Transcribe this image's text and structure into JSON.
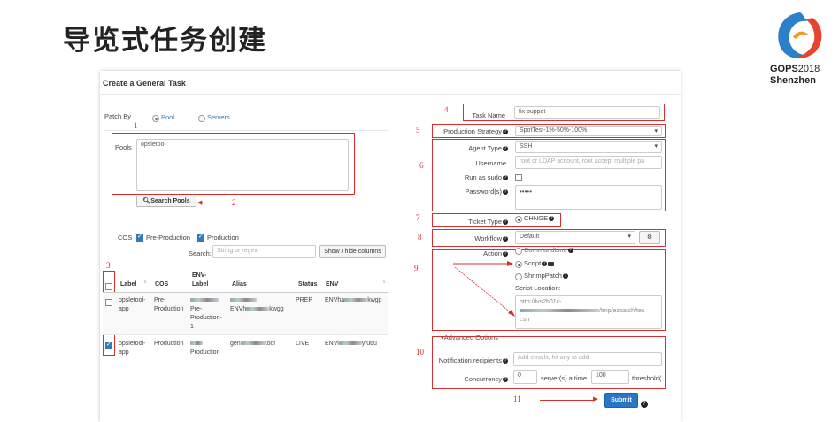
{
  "slide": {
    "title": "导览式任务创建",
    "logo": {
      "brand": "GOPS",
      "year": "2018",
      "city": "Shenzhen"
    }
  },
  "panel": {
    "title": "Create a General Task"
  },
  "left": {
    "patch_by": {
      "label": "Patch By",
      "options": [
        "Pool",
        "Servers"
      ],
      "selected": "Pool"
    },
    "pools": {
      "label": "Pools",
      "value": "opsletool"
    },
    "search_pools_button": "Search Pools",
    "filters": {
      "cos_label": "COS",
      "options": [
        "Pre-Production",
        "Production"
      ],
      "checked": [
        "Pre-Production",
        "Production"
      ]
    },
    "search": {
      "label": "Search:",
      "placeholder": "String or regex"
    },
    "show_hide_columns_button": "Show / hide columns",
    "table": {
      "headers": {
        "label": "Label",
        "cos": "COS",
        "env_label_1": "ENV-",
        "env_label_2": "Label",
        "alias": "Alias",
        "status": "Status",
        "env": "ENV"
      },
      "rows": [
        {
          "label_1": "opsletool-",
          "label_2": "app",
          "cos_1": "Pre-",
          "cos_2": "Production",
          "env_label_1": "Pre-",
          "env_label_2": "Production-",
          "env_label_3": "1",
          "alias": "",
          "env_alias": "ENVh",
          "env_alias_tail": "kwgg",
          "status": "PREP",
          "env": "ENVha",
          "env_tail": "kwgg",
          "checked": false
        },
        {
          "label_1": "opsletool-",
          "label_2": "app",
          "cos_1": "Production",
          "cos_2": "",
          "env_label_1": "",
          "env_label_2": "Production",
          "env_label_3": "",
          "alias": "gen",
          "alias_tail": "tool",
          "status": "LIVE",
          "env": "ENVi",
          "env_tail": "yfu6u",
          "checked": true
        }
      ]
    }
  },
  "right": {
    "task_name": {
      "label": "Task Name",
      "value": "fix puppet"
    },
    "production_strategy": {
      "label": "Production Strategy",
      "value": "SpotTest-1%-50%-100%"
    },
    "agent_type": {
      "label": "Agent Type",
      "value": "SSH"
    },
    "username": {
      "label": "Username",
      "placeholder": "root or LDAP account, root accept multiple pa"
    },
    "run_as_sudo": {
      "label": "Run as sudo"
    },
    "password": {
      "label": "Password(s)",
      "value": "•••••"
    },
    "ticket_type": {
      "label": "Ticket Type",
      "value": "CHNGE"
    },
    "workflow": {
      "label": "Workflow",
      "value": "Default"
    },
    "action": {
      "label": "Action",
      "options": [
        "CommandLine",
        "Script",
        "ShrimpPatch"
      ],
      "selected": "Script",
      "script_location_label": "Script Location:",
      "script_url_1": "http://lvs2b01c-",
      "script_url_2": "/tmp/ezpatch/tes",
      "script_url_3": "t.sh"
    },
    "advanced": {
      "toggle": "Advanced Options",
      "notification": {
        "label": "Notification recipients",
        "placeholder": "Add emails, hit any to add"
      },
      "concurrency": {
        "label": "Concurrency",
        "value": "0",
        "mid_text": "server(s) a time",
        "threshold_value": "100",
        "tail_text": "threshold("
      }
    },
    "submit_button": "Submit"
  },
  "annotations": [
    "1",
    "2",
    "3",
    "4",
    "5",
    "6",
    "7",
    "8",
    "9",
    "10",
    "11"
  ],
  "colors": {
    "annotation_red": "#d62f2f",
    "primary_blue": "#2a76c6",
    "link_blue": "#337ab7"
  }
}
